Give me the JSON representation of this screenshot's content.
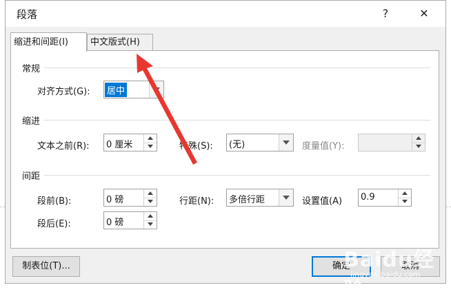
{
  "dialog": {
    "title": "段落",
    "help": "?",
    "close": "✕"
  },
  "tabs": [
    {
      "label": "缩进和间距(I)",
      "active": true
    },
    {
      "label": "中文版式(H)",
      "active": false
    }
  ],
  "general": {
    "section": "常规",
    "alignment_label": "对齐方式(G):",
    "alignment_value": "居中"
  },
  "indent": {
    "section": "缩进",
    "before_label": "文本之前(R):",
    "before_value": "0 厘米",
    "special_label": "特殊(S):",
    "special_value": "(无)",
    "by_label": "度量值(Y):",
    "by_value": ""
  },
  "spacing": {
    "section": "间距",
    "before_label": "段前(B):",
    "before_value": "0 磅",
    "after_label": "段后(E):",
    "after_value": "0 磅",
    "line_label": "行距(N):",
    "line_value": "多倍行距",
    "at_label": "设置值(A)",
    "at_value": "0.9"
  },
  "buttons": {
    "tabs": "制表位(T)...",
    "ok": "确定",
    "cancel": "取消"
  },
  "watermark": {
    "main": "Baidu经验",
    "sub": "jingyan.baidu.com"
  },
  "colors": {
    "accent": "#0078d7",
    "annotation": "#e8372f"
  }
}
